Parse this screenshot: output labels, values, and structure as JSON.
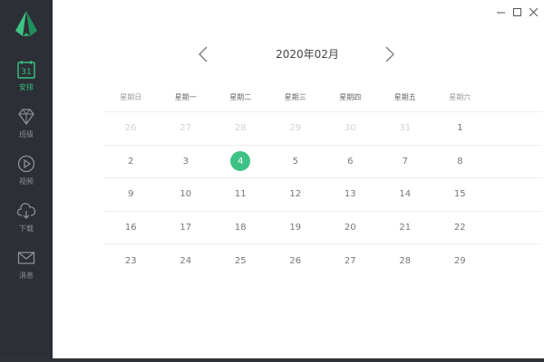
{
  "colors": {
    "accent": "#3ec284",
    "sidebar": "#2c2f36",
    "muted": "#d2d2d2"
  },
  "sidebar": {
    "items": [
      {
        "label": "安排",
        "icon": "calendar-icon",
        "badge": "31",
        "active": true
      },
      {
        "label": "班级",
        "icon": "diamond-icon",
        "active": false
      },
      {
        "label": "视频",
        "icon": "play-icon",
        "active": false
      },
      {
        "label": "下载",
        "icon": "cloud-download-icon",
        "active": false
      },
      {
        "label": "消息",
        "icon": "mail-icon",
        "active": false
      }
    ]
  },
  "calendar": {
    "title": "2020年02月",
    "weekdays": [
      "星期日",
      "星期一",
      "星期二",
      "星期三",
      "星期四",
      "星期五",
      "星期六"
    ],
    "today": "4",
    "weeks": [
      [
        "26",
        "27",
        "28",
        "29",
        "30",
        "31",
        "1"
      ],
      [
        "2",
        "3",
        "4",
        "5",
        "6",
        "7",
        "8"
      ],
      [
        "9",
        "10",
        "11",
        "12",
        "13",
        "14",
        "15"
      ],
      [
        "16",
        "17",
        "18",
        "19",
        "20",
        "21",
        "22"
      ],
      [
        "23",
        "24",
        "25",
        "26",
        "27",
        "28",
        "29"
      ]
    ],
    "muted_first_week_count": 6
  }
}
